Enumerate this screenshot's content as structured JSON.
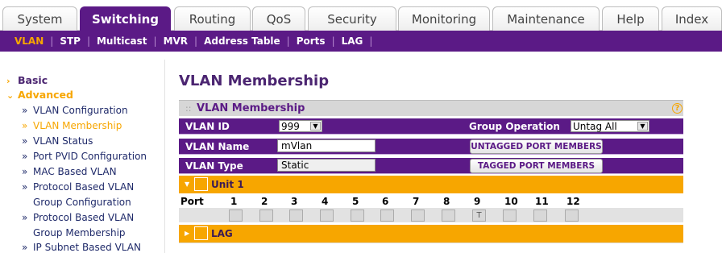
{
  "top_tabs": [
    "System",
    "Switching",
    "Routing",
    "QoS",
    "Security",
    "Monitoring",
    "Maintenance",
    "Help",
    "Index"
  ],
  "sub_nav": [
    "VLAN",
    "STP",
    "Multicast",
    "MVR",
    "Address Table",
    "Ports",
    "LAG"
  ],
  "sidebar": {
    "basic": "Basic",
    "advanced": "Advanced",
    "items": [
      "VLAN Configuration",
      "VLAN Membership",
      "VLAN Status",
      "Port PVID Configuration",
      "MAC Based VLAN",
      "Protocol Based VLAN",
      "Group Configuration",
      "Protocol Based VLAN",
      "Group Membership",
      "IP Subnet Based VLAN"
    ]
  },
  "main": {
    "page_title": "VLAN Membership",
    "panel_title": "VLAN Membership",
    "vlan_id_label": "VLAN ID",
    "vlan_id_value": "999",
    "group_operation_label": "Group Operation",
    "group_operation_value": "Untag All",
    "vlan_name_label": "VLAN Name",
    "vlan_name_value": "mVlan",
    "untagged_button": "UNTAGGED PORT MEMBERS",
    "vlan_type_label": "VLAN Type",
    "vlan_type_value": "Static",
    "tagged_button": "TAGGED PORT MEMBERS",
    "unit_label": "Unit 1",
    "port_label": "Port",
    "ports": [
      "1",
      "2",
      "3",
      "4",
      "5",
      "6",
      "7",
      "8",
      "9",
      "10",
      "11",
      "12"
    ],
    "port_states": [
      "",
      "",
      "",
      "",
      "",
      "",
      "",
      "",
      "T",
      "",
      "",
      ""
    ],
    "lag_label": "LAG"
  },
  "colors": {
    "purple": "#5b1a86",
    "orange": "#f7a600"
  }
}
